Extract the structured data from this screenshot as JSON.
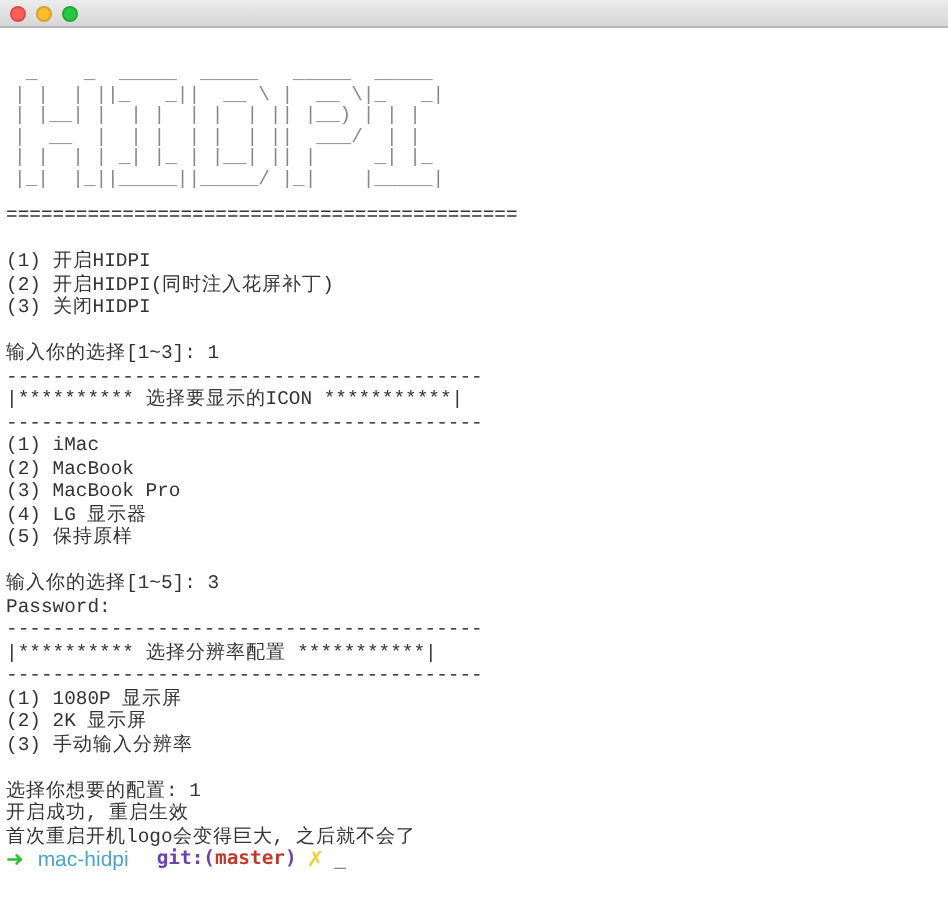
{
  "window": {
    "controls": [
      {
        "kind": "close"
      },
      {
        "kind": "minimize"
      },
      {
        "kind": "zoom"
      }
    ]
  },
  "ascii_art": [
    " _    _  _____  _____   _____  _____ ",
    "| |  | ||_   _||  __ \\ |  __ \\|_   _|",
    "| |__| |  | |  | |  | || |__) | | |  ",
    "|  __  |  | |  | |  | ||  ___/  | |  ",
    "| |  | | _| |_ | |__| || |     _| |_ ",
    "|_|  |_||_____||_____/ |_|    |_____|"
  ],
  "lines": [
    {
      "kind": "text",
      "text": "============================================"
    },
    {
      "kind": "gap"
    },
    {
      "kind": "text",
      "text": "(1) 开启HIDPI"
    },
    {
      "kind": "text",
      "text": "(2) 开启HIDPI(同时注入花屏补丁)"
    },
    {
      "kind": "text",
      "text": "(3) 关闭HIDPI"
    },
    {
      "kind": "gap"
    },
    {
      "kind": "text",
      "text": "输入你的选择[1~3]: 1"
    },
    {
      "kind": "text",
      "text": "-----------------------------------------"
    },
    {
      "kind": "text",
      "text": "|********** 选择要显示的ICON ***********|"
    },
    {
      "kind": "text",
      "text": "-----------------------------------------"
    },
    {
      "kind": "text",
      "text": "(1) iMac"
    },
    {
      "kind": "text",
      "text": "(2) MacBook"
    },
    {
      "kind": "text",
      "text": "(3) MacBook Pro"
    },
    {
      "kind": "text",
      "text": "(4) LG 显示器"
    },
    {
      "kind": "text",
      "text": "(5) 保持原样"
    },
    {
      "kind": "gap"
    },
    {
      "kind": "text",
      "text": "输入你的选择[1~5]: 3"
    },
    {
      "kind": "text",
      "text": "Password:"
    },
    {
      "kind": "text",
      "text": "-----------------------------------------"
    },
    {
      "kind": "text",
      "text": "|********** 选择分辨率配置 ***********|"
    },
    {
      "kind": "text",
      "text": "-----------------------------------------"
    },
    {
      "kind": "text",
      "text": "(1) 1080P 显示屏"
    },
    {
      "kind": "text",
      "text": "(2) 2K 显示屏"
    },
    {
      "kind": "text",
      "text": "(3) 手动输入分辨率"
    },
    {
      "kind": "gap"
    },
    {
      "kind": "text",
      "text": "选择你想要的配置: 1"
    },
    {
      "kind": "text",
      "text": "开启成功, 重启生效"
    },
    {
      "kind": "text",
      "text": "首次重启开机logo会变得巨大, 之后就不会了"
    }
  ],
  "prompt": {
    "arrow": "➜",
    "directory": "mac-hidpi",
    "git_label": "git:(",
    "branch": "master",
    "git_close": ")",
    "dirty_mark": "✗",
    "cursor": "_"
  }
}
